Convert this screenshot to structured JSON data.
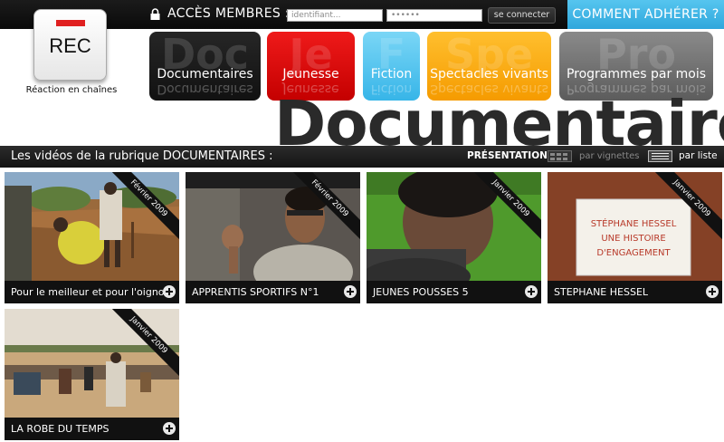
{
  "header": {
    "lock_icon": "lock-icon",
    "members_label": "ACCÈS MEMBRES :",
    "login_placeholder": "identifiant...",
    "password_value": "••••••",
    "connect_label": "se connecter",
    "join_label": "COMMENT ADHÉRER ?"
  },
  "logo": {
    "text": "REC",
    "tagline": "Réaction en chaînes"
  },
  "nav": {
    "items": [
      {
        "label": "Documentaires",
        "ghost": "Doc"
      },
      {
        "label": "Jeunesse",
        "ghost": "Je"
      },
      {
        "label": "Fiction",
        "ghost": "F"
      },
      {
        "label": "Spectacles vivants",
        "ghost": "Spe"
      },
      {
        "label": "Programmes par mois",
        "ghost": "Pro"
      }
    ]
  },
  "page_heading": "Documentaires",
  "section": {
    "title": "Les vidéos de la rubrique DOCUMENTAIRES :",
    "presentation_label": "PRÉSENTATION :",
    "vignettes_label": "par vignettes",
    "list_label": "par liste"
  },
  "videos": [
    {
      "title": "Pour le meilleur et pour l'oignon",
      "date": "Février 2009"
    },
    {
      "title": "APPRENTIS SPORTIFS N°1",
      "date": "Février 2009"
    },
    {
      "title": "JEUNES POUSSES 5",
      "date": "Janvier 2009"
    },
    {
      "title": "STEPHANE HESSEL",
      "date": "Janvier 2009"
    },
    {
      "title": "LA ROBE DU TEMPS",
      "date": "Janvier 2009"
    }
  ],
  "thumb_sign": {
    "line1": "STÉPHANE HESSEL",
    "line2": "UNE HISTOIRE",
    "line3": "D'ENGAGEMENT"
  },
  "colors": {
    "join_blue": "#2fa7dc",
    "nav_black": "#1a1a1a",
    "nav_red": "#d80000",
    "nav_cyan": "#37b5e8",
    "nav_orange": "#f59b00",
    "nav_gray": "#6e6e6e",
    "logo_red": "#e02020"
  }
}
